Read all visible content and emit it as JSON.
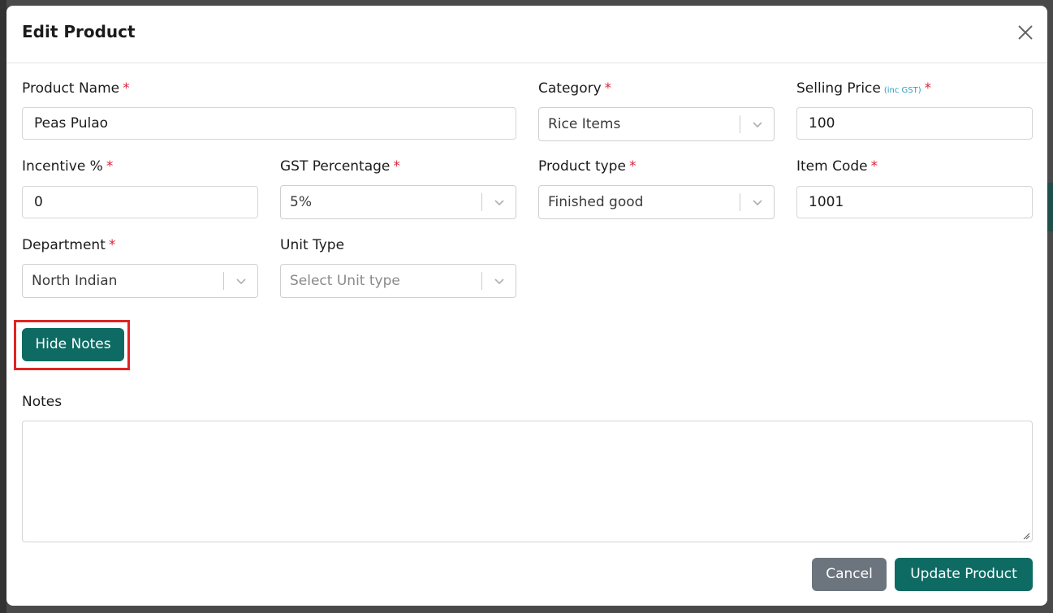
{
  "modal": {
    "title": "Edit Product"
  },
  "fields": {
    "product_name": {
      "label": "Product Name",
      "required_mark": "*",
      "value": "Peas Pulao"
    },
    "category": {
      "label": "Category",
      "required_mark": "*",
      "value": "Rice Items"
    },
    "selling_price": {
      "label": "Selling Price",
      "hint": "(inc GST)",
      "required_mark": "*",
      "value": "100"
    },
    "incentive": {
      "label": "Incentive %",
      "required_mark": "*",
      "value": "0"
    },
    "gst_percentage": {
      "label": "GST Percentage",
      "required_mark": "*",
      "value": "5%"
    },
    "product_type": {
      "label": "Product type",
      "required_mark": "*",
      "value": "Finished good"
    },
    "item_code": {
      "label": "Item Code",
      "required_mark": "*",
      "value": "1001"
    },
    "department": {
      "label": "Department",
      "required_mark": "*",
      "value": "North Indian"
    },
    "unit_type": {
      "label": "Unit Type",
      "placeholder": "Select Unit type"
    },
    "notes": {
      "label": "Notes",
      "value": ""
    }
  },
  "buttons": {
    "hide_notes": "Hide Notes",
    "cancel": "Cancel",
    "update": "Update Product"
  },
  "colors": {
    "primary": "#0e6b63",
    "secondary": "#6c757d",
    "required": "#d9263b",
    "highlight": "#e02424",
    "hint": "#2a9cc2"
  },
  "icons": {
    "close": "close-icon",
    "dropdown": "chevron-down-icon",
    "resize": "resize-grip-icon"
  }
}
